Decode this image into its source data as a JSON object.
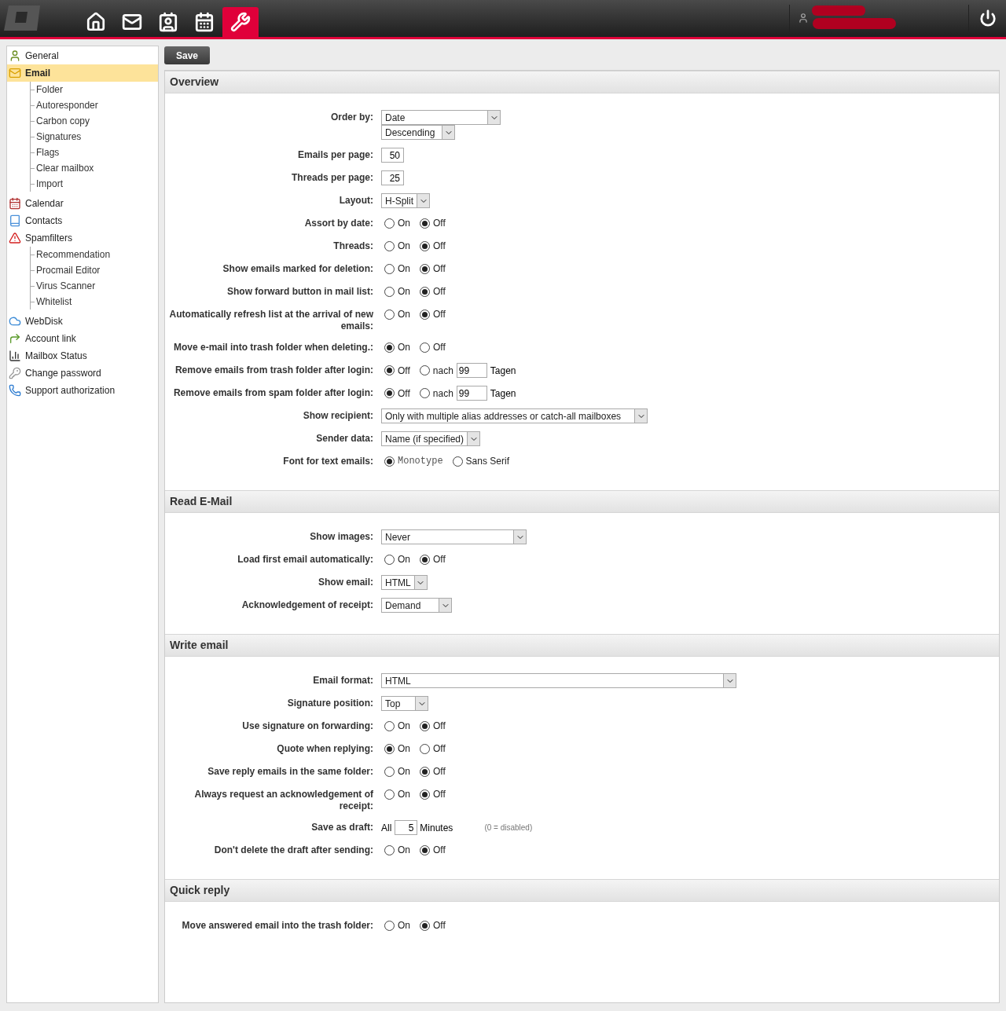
{
  "topnav": [
    {
      "kind": "home",
      "selected": false
    },
    {
      "kind": "mail",
      "selected": false
    },
    {
      "kind": "contacts",
      "selected": false
    },
    {
      "kind": "calendar",
      "selected": false
    },
    {
      "kind": "tools",
      "selected": true
    }
  ],
  "sidebar": {
    "items": [
      {
        "label": "General",
        "kind": "user",
        "selected": false
      },
      {
        "label": "Email",
        "kind": "mail",
        "selected": true,
        "children": [
          {
            "label": "Folder"
          },
          {
            "label": "Autoresponder"
          },
          {
            "label": "Carbon copy"
          },
          {
            "label": "Signatures"
          },
          {
            "label": "Flags"
          },
          {
            "label": "Clear mailbox"
          },
          {
            "label": "Import"
          }
        ]
      },
      {
        "label": "Calendar",
        "kind": "calendar",
        "selected": false
      },
      {
        "label": "Contacts",
        "kind": "book",
        "selected": false
      },
      {
        "label": "Spamfilters",
        "kind": "warning",
        "selected": false,
        "children": [
          {
            "label": "Recommendation"
          },
          {
            "label": "Procmail Editor"
          },
          {
            "label": "Virus Scanner"
          },
          {
            "label": "Whitelist"
          }
        ]
      },
      {
        "label": "WebDisk",
        "kind": "cloud",
        "selected": false
      },
      {
        "label": "Account link",
        "kind": "link",
        "selected": false
      },
      {
        "label": "Mailbox Status",
        "kind": "bars",
        "selected": false
      },
      {
        "label": "Change password",
        "kind": "key",
        "selected": false
      },
      {
        "label": "Support authorization",
        "kind": "phone",
        "selected": false
      }
    ]
  },
  "save_button": "Save",
  "sections": [
    {
      "title": "Overview",
      "rows": [
        {
          "kind": "select",
          "label": "Order by:",
          "selects": [
            "Date",
            "Descending"
          ]
        },
        {
          "kind": "number",
          "label": "Emails per page:",
          "value": "50"
        },
        {
          "kind": "number",
          "label": "Threads per page:",
          "value": "25"
        },
        {
          "kind": "select",
          "label": "Layout:",
          "selects": [
            "H-Split"
          ]
        },
        {
          "kind": "radio",
          "label": "Assort by date:",
          "options": [
            {
              "label": "On",
              "selected": false
            },
            {
              "label": "Off",
              "selected": true
            }
          ]
        },
        {
          "kind": "radio",
          "label": "Threads:",
          "options": [
            {
              "label": "On",
              "selected": false
            },
            {
              "label": "Off",
              "selected": true
            }
          ]
        },
        {
          "kind": "radio",
          "label": "Show emails marked for deletion:",
          "options": [
            {
              "label": "On",
              "selected": false
            },
            {
              "label": "Off",
              "selected": true
            }
          ]
        },
        {
          "kind": "radio",
          "label": "Show forward button in mail list:",
          "options": [
            {
              "label": "On",
              "selected": false
            },
            {
              "label": "Off",
              "selected": true
            }
          ]
        },
        {
          "kind": "radio",
          "label": "Automatically refresh list at the arrival of new emails:",
          "options": [
            {
              "label": "On",
              "selected": false
            },
            {
              "label": "Off",
              "selected": true
            }
          ]
        },
        {
          "kind": "radio",
          "label": "Move e-mail into trash folder when deleting.:",
          "options": [
            {
              "label": "On",
              "selected": true
            },
            {
              "label": "Off",
              "selected": false
            }
          ]
        },
        {
          "kind": "days",
          "label": "Remove emails from trash folder after login:",
          "options": [
            {
              "label": "Off",
              "selected": true
            },
            {
              "label": "nach",
              "selected": false
            }
          ],
          "value": "99",
          "suffix": "Tagen"
        },
        {
          "kind": "days",
          "label": "Remove emails from spam folder after login:",
          "options": [
            {
              "label": "Off",
              "selected": true
            },
            {
              "label": "nach",
              "selected": false
            }
          ],
          "value": "99",
          "suffix": "Tagen"
        },
        {
          "kind": "select",
          "label": "Show recipient:",
          "selects": [
            "Only with multiple alias addresses or catch-all mailboxes"
          ]
        },
        {
          "kind": "select",
          "label": "Sender data:",
          "selects": [
            "Name (if specified)"
          ]
        },
        {
          "kind": "font",
          "label": "Font for text emails:",
          "options": [
            {
              "label": "Monotype",
              "selected": true
            },
            {
              "label": "Sans Serif",
              "selected": false
            }
          ]
        }
      ]
    },
    {
      "title": "Read E-Mail",
      "rows": [
        {
          "kind": "select",
          "label": "Show images:",
          "selects": [
            "Never"
          ]
        },
        {
          "kind": "radio",
          "label": "Load first email automatically:",
          "options": [
            {
              "label": "On",
              "selected": false
            },
            {
              "label": "Off",
              "selected": true
            }
          ]
        },
        {
          "kind": "select",
          "label": "Show email:",
          "selects": [
            "HTML"
          ]
        },
        {
          "kind": "select",
          "label": "Acknowledgement of receipt:",
          "selects": [
            "Demand"
          ]
        }
      ]
    },
    {
      "title": "Write email",
      "rows": [
        {
          "kind": "select",
          "label": "Email format:",
          "selects": [
            "HTML"
          ]
        },
        {
          "kind": "select",
          "label": "Signature position:",
          "selects": [
            "Top"
          ]
        },
        {
          "kind": "radio",
          "label": "Use signature on forwarding:",
          "options": [
            {
              "label": "On",
              "selected": false
            },
            {
              "label": "Off",
              "selected": true
            }
          ]
        },
        {
          "kind": "radio",
          "label": "Quote when replying:",
          "options": [
            {
              "label": "On",
              "selected": true
            },
            {
              "label": "Off",
              "selected": false
            }
          ]
        },
        {
          "kind": "radio",
          "label": "Save reply emails in the same folder:",
          "options": [
            {
              "label": "On",
              "selected": false
            },
            {
              "label": "Off",
              "selected": true
            }
          ]
        },
        {
          "kind": "radio",
          "label": "Always request an acknowledgement of receipt:",
          "options": [
            {
              "label": "On",
              "selected": false
            },
            {
              "label": "Off",
              "selected": true
            }
          ]
        },
        {
          "kind": "draft",
          "label": "Save as draft:",
          "prefix": "All",
          "value": "5",
          "suffix": "Minutes",
          "note": "(0 = disabled)"
        },
        {
          "kind": "radio",
          "label": "Don't delete the draft after sending:",
          "options": [
            {
              "label": "On",
              "selected": false
            },
            {
              "label": "Off",
              "selected": true
            }
          ]
        }
      ]
    },
    {
      "title": "Quick reply",
      "rows": [
        {
          "kind": "radio",
          "label": "Move answered email into the trash folder:",
          "options": [
            {
              "label": "On",
              "selected": false
            },
            {
              "label": "Off",
              "selected": true
            }
          ]
        }
      ]
    }
  ]
}
